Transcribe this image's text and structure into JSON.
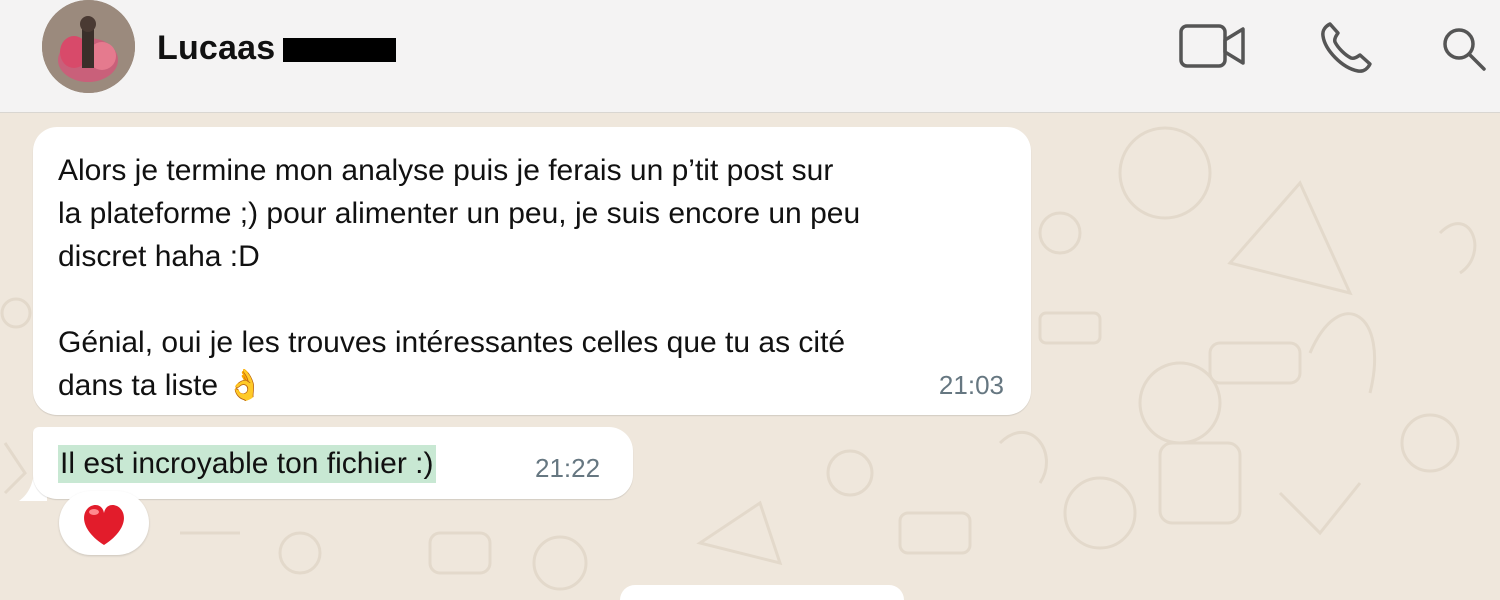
{
  "contact": {
    "name": "Lucaas"
  },
  "messages": [
    {
      "text": "Alors je termine mon analyse puis je ferais un p’tit post sur\nla plateforme ;) pour alimenter un peu, je suis encore un peu\ndiscret haha :D\n\nGénial, oui je les trouves intéressantes celles que tu as cité\ndans ta liste 👌",
      "time": "21:03"
    },
    {
      "text": "Il est incroyable ton fichier :)",
      "time": "21:22",
      "reaction": "❤️"
    }
  ],
  "icons": [
    "video-call-icon",
    "phone-call-icon",
    "search-icon"
  ]
}
